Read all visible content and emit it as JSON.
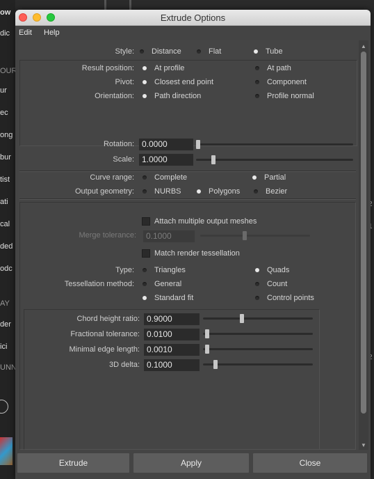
{
  "background_fragments": [
    "ow",
    "dic",
    "OUR",
    "ur",
    "ec",
    "ong",
    "bur",
    "tist",
    "ati",
    "cal",
    "ded",
    "odc",
    "AY",
    "der",
    "ici",
    "UNN",
    "2",
    "1",
    "2"
  ],
  "window": {
    "title": "Extrude Options"
  },
  "menu": {
    "edit": "Edit",
    "help": "Help"
  },
  "style_row": {
    "label": "Style:",
    "options": [
      "Distance",
      "Flat",
      "Tube"
    ],
    "selected": "Tube"
  },
  "result_position": {
    "label": "Result position:",
    "options": [
      "At profile",
      "At path"
    ],
    "selected": "At profile"
  },
  "pivot": {
    "label": "Pivot:",
    "options": [
      "Closest end point",
      "Component"
    ],
    "selected": "Closest end point"
  },
  "orientation": {
    "label": "Orientation:",
    "options": [
      "Path direction",
      "Profile normal"
    ],
    "selected": "Path direction"
  },
  "rotation": {
    "label": "Rotation:",
    "value": "0.0000",
    "slider_fraction": 0.0
  },
  "scale": {
    "label": "Scale:",
    "value": "1.0000",
    "slider_fraction": 0.1
  },
  "curve_range": {
    "label": "Curve range:",
    "options": [
      "Complete",
      "Partial"
    ],
    "selected": "Partial"
  },
  "output_geometry": {
    "label": "Output geometry:",
    "options": [
      "NURBS",
      "Polygons",
      "Bezier"
    ],
    "selected": "Polygons"
  },
  "attach_multiple": {
    "label": "Attach multiple output meshes",
    "checked": false
  },
  "merge_tolerance": {
    "label": "Merge tolerance:",
    "value": "0.1000",
    "enabled": false,
    "slider_fraction": 0.4
  },
  "match_render": {
    "label": "Match render tessellation",
    "checked": false
  },
  "type_row": {
    "label": "Type:",
    "options": [
      "Triangles",
      "Quads"
    ],
    "selected": "Quads"
  },
  "tessellation_method": {
    "label": "Tessellation method:",
    "options": [
      "General",
      "Count",
      "Standard fit",
      "Control points"
    ],
    "selected": "Standard fit"
  },
  "chord_height_ratio": {
    "label": "Chord height ratio:",
    "value": "0.9000",
    "slider_fraction": 0.35
  },
  "fractional_tolerance": {
    "label": "Fractional tolerance:",
    "value": "0.0100",
    "slider_fraction": 0.02
  },
  "minimal_edge_length": {
    "label": "Minimal edge length:",
    "value": "0.0010",
    "slider_fraction": 0.02
  },
  "delta_3d": {
    "label": "3D delta:",
    "value": "0.1000",
    "slider_fraction": 0.1
  },
  "buttons": {
    "extrude": "Extrude",
    "apply": "Apply",
    "close": "Close"
  },
  "colors": {
    "panel": "#454545",
    "field": "#2b2b2b",
    "title_bar": "#dcdcdc",
    "close_dot": "#fe5f57",
    "minimize_dot": "#febc2e",
    "zoom_dot": "#28c840"
  }
}
